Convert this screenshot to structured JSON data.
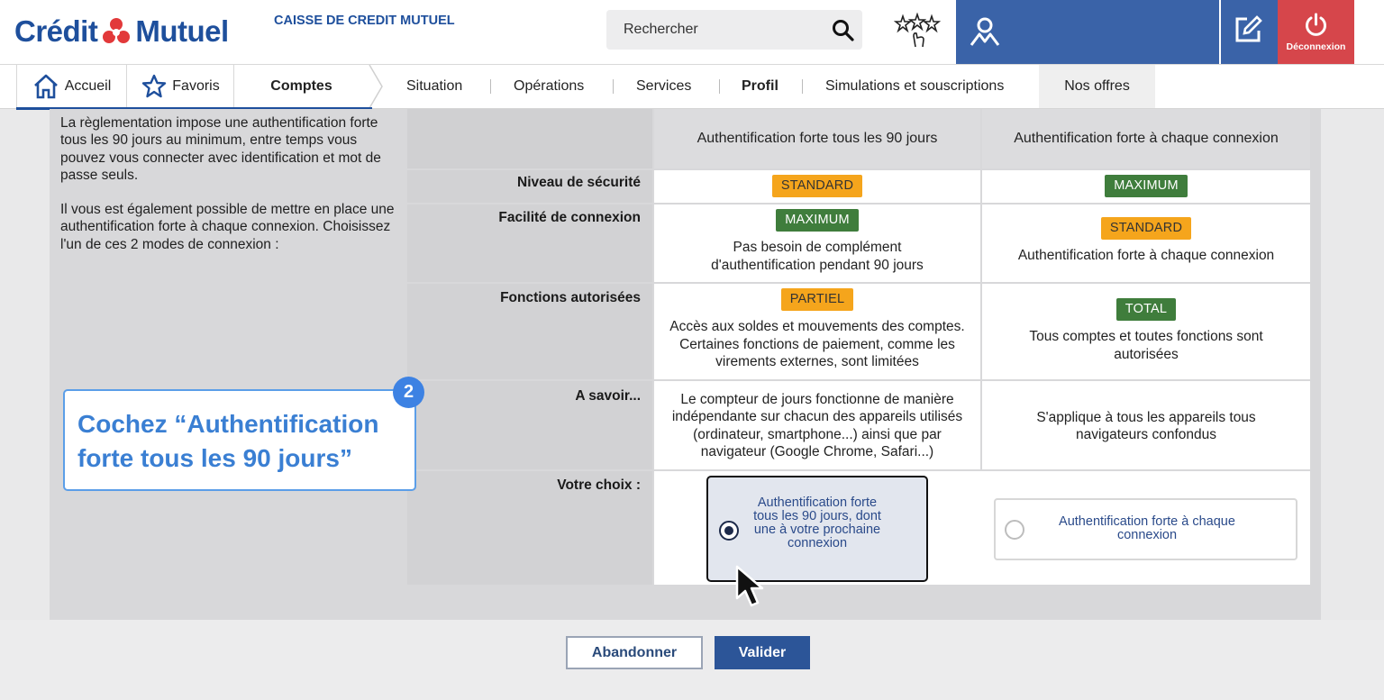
{
  "header": {
    "brand_left": "Crédit",
    "brand_right": "Mutuel",
    "caisse": "CAISSE DE CREDIT MUTUEL",
    "search_placeholder": "Rechercher",
    "logout_label": "Déconnexion",
    "colors": {
      "brand_blue": "#1e4f9c",
      "bar_blue": "#3a63a8",
      "logout_red": "#d6464b"
    }
  },
  "nav": {
    "home": "Accueil",
    "favorites": "Favoris",
    "accounts": "Comptes",
    "items": [
      "Situation",
      "Opérations",
      "Services",
      "Profil",
      "Simulations et souscriptions"
    ],
    "selected": "Profil",
    "offers": "Nos offres"
  },
  "intro": {
    "p1": "La règlementation impose une authentification forte tous les 90 jours au minimum, entre temps vous pouvez vous connecter avec identification et mot de passe seuls.",
    "p2": "Il vous est également possible de mettre en place une authentification forte à chaque connexion. Choisissez l'un de ces 2 modes de connexion :"
  },
  "table": {
    "col1": "Authentification forte tous les 90 jours",
    "col2": "Authentification forte à chaque connexion",
    "rows": [
      {
        "label": "Niveau de sécurité",
        "b1": "STANDARD",
        "b2": "MAXIMUM"
      },
      {
        "label": "Facilité de connexion",
        "b1": "MAXIMUM",
        "t1": "Pas besoin de complément d'authentification pendant 90 jours",
        "b2": "STANDARD",
        "t2": "Authentification forte à chaque connexion"
      },
      {
        "label": "Fonctions autorisées",
        "b1": "PARTIEL",
        "t1": "Accès aux soldes et mouvements des comptes. Certaines fonctions de paiement, comme les virements externes, sont limitées",
        "b2": "TOTAL",
        "t2": "Tous comptes et toutes fonctions sont autorisées"
      },
      {
        "label": "A savoir...",
        "t1": "Le compteur de jours fonctionne de manière indépendante sur chacun des appareils utilisés (ordinateur, smartphone...) ainsi que par navigateur (Google Chrome, Safari...)",
        "t2": "S'applique à tous les appareils tous navigateurs confondus"
      },
      {
        "label": "Votre choix :"
      }
    ],
    "choice1": "Authentification forte tous les 90 jours, dont une à votre prochaine connexion",
    "choice2": "Authentification forte à chaque connexion"
  },
  "callout": {
    "step": "2",
    "text": "Cochez “Authentification forte tous les 90 jours”"
  },
  "buttons": {
    "cancel": "Abandonner",
    "submit": "Valider"
  }
}
